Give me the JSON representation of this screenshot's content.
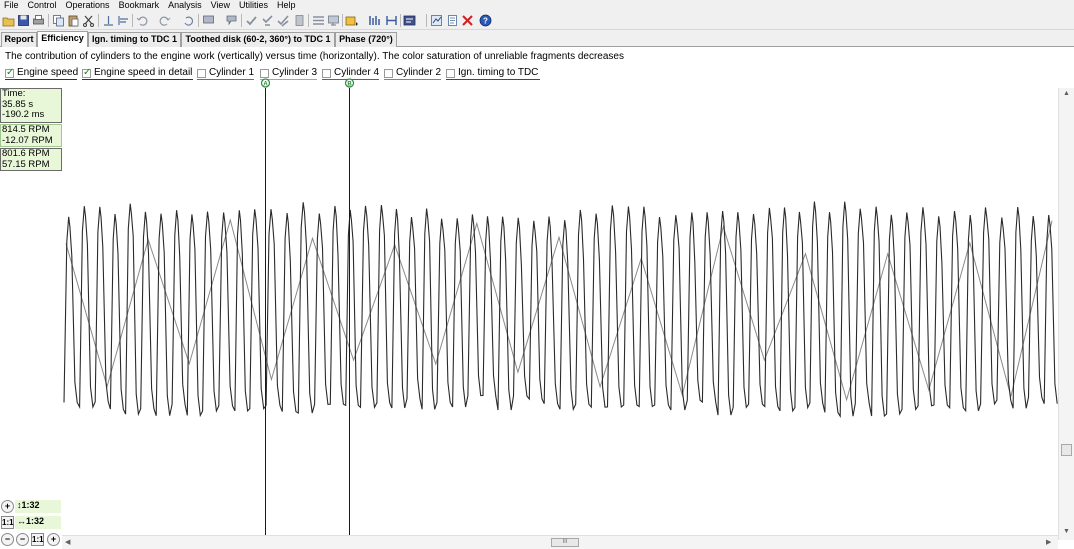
{
  "menu": [
    "File",
    "Control",
    "Operations",
    "Bookmark",
    "Analysis",
    "View",
    "Utilities",
    "Help"
  ],
  "toolbar_icons": [
    "open-icon",
    "save-icon",
    "print-icon",
    "copy-icon",
    "paste-icon",
    "cut-icon",
    "align-bottom-icon",
    "align-left-icon",
    "undo-icon",
    "redo-icon",
    "rotate-icon",
    "chat-icon",
    "flag-icon",
    "check-icon",
    "check-down-icon",
    "check-all-icon",
    "page-icon",
    "grid-icon",
    "screen-icon",
    "sync-icon",
    "bars-icon",
    "marker-icon",
    "chart-icon",
    "document-icon",
    "close-red-icon",
    "help-icon"
  ],
  "tabs": [
    {
      "label": "Report",
      "active": false
    },
    {
      "label": "Efficiency",
      "active": true
    },
    {
      "label": "Ign. timing to TDC 1",
      "active": false
    },
    {
      "label": "Toothed disk (60-2, 360°) to TDC 1",
      "active": false
    },
    {
      "label": "Phase (720°)",
      "active": false
    }
  ],
  "description": "The contribution of cylinders to the engine work (vertically) versus time (horizontally). The color saturation of unreliable fragments decreases",
  "legend": [
    {
      "label": "Engine speed",
      "checked": true,
      "color": "#333333"
    },
    {
      "label": "Engine speed in detail",
      "checked": true,
      "color": "#333333"
    },
    {
      "label": "Cylinder 1",
      "checked": false,
      "color": "#e04040"
    },
    {
      "label": "Cylinder 3",
      "checked": false,
      "color": "#e0a020"
    },
    {
      "label": "Cylinder 4",
      "checked": false,
      "color": "#2a8a2a"
    },
    {
      "label": "Cylinder 2",
      "checked": false,
      "color": "#2aa0d8"
    },
    {
      "label": "Ign. timing to TDC",
      "checked": false,
      "color": "#7a3a10"
    }
  ],
  "readouts": {
    "time": {
      "title": "Time:",
      "a": "35.85 s",
      "b": "-190.2 ms"
    },
    "rpm1": {
      "a": "814.5 RPM",
      "b": "-12.07 RPM"
    },
    "rpm2": {
      "a": "801.6 RPM",
      "b": "57.15 RPM"
    }
  },
  "markers": [
    {
      "label": "A",
      "color": "#2a8a3a"
    },
    {
      "label": "B",
      "color": "#2a8a3a"
    }
  ],
  "zoom": {
    "vertical": "1:32",
    "horizontal": "1:32",
    "one_to_one": "1:1"
  },
  "scroll_grip": "III"
}
